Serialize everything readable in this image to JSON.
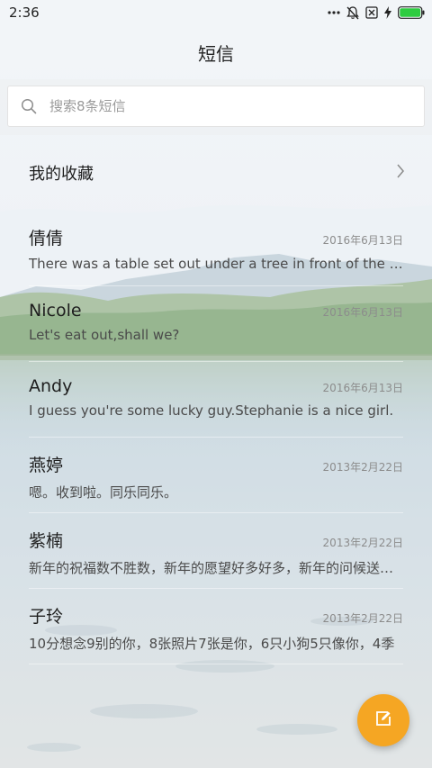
{
  "status_bar": {
    "time": "2:36",
    "icons": [
      "more-dots-icon",
      "bell-off-icon",
      "sim-off-icon",
      "charging-icon",
      "battery-icon"
    ],
    "battery_color": "#2ecc40"
  },
  "header": {
    "title": "短信"
  },
  "search": {
    "placeholder": "搜索8条短信",
    "value": ""
  },
  "favorites": {
    "label": "我的收藏"
  },
  "messages": [
    {
      "contact": "倩倩",
      "date": "2016年6月13日",
      "preview": "There was a table set out under a tree in front of the house"
    },
    {
      "contact": "Nicole",
      "date": "2016年6月13日",
      "preview": "Let's eat out,shall we?"
    },
    {
      "contact": "Andy",
      "date": "2016年6月13日",
      "preview": "I guess you're some lucky guy.Stephanie is a nice girl."
    },
    {
      "contact": "燕婷",
      "date": "2013年2月22日",
      "preview": "嗯。收到啦。同乐同乐。"
    },
    {
      "contact": "紫楠",
      "date": "2013年2月22日",
      "preview": "新年的祝福数不胜数，新年的愿望好多好多，新年的问候送给你"
    },
    {
      "contact": "子玲",
      "date": "2013年2月22日",
      "preview": "10分想念9别的你，8张照片7张是你，6只小狗5只像你，4季"
    }
  ],
  "fab": {
    "icon": "compose-icon",
    "color": "#f5a623"
  },
  "colors": {
    "accent": "#f5a623"
  }
}
